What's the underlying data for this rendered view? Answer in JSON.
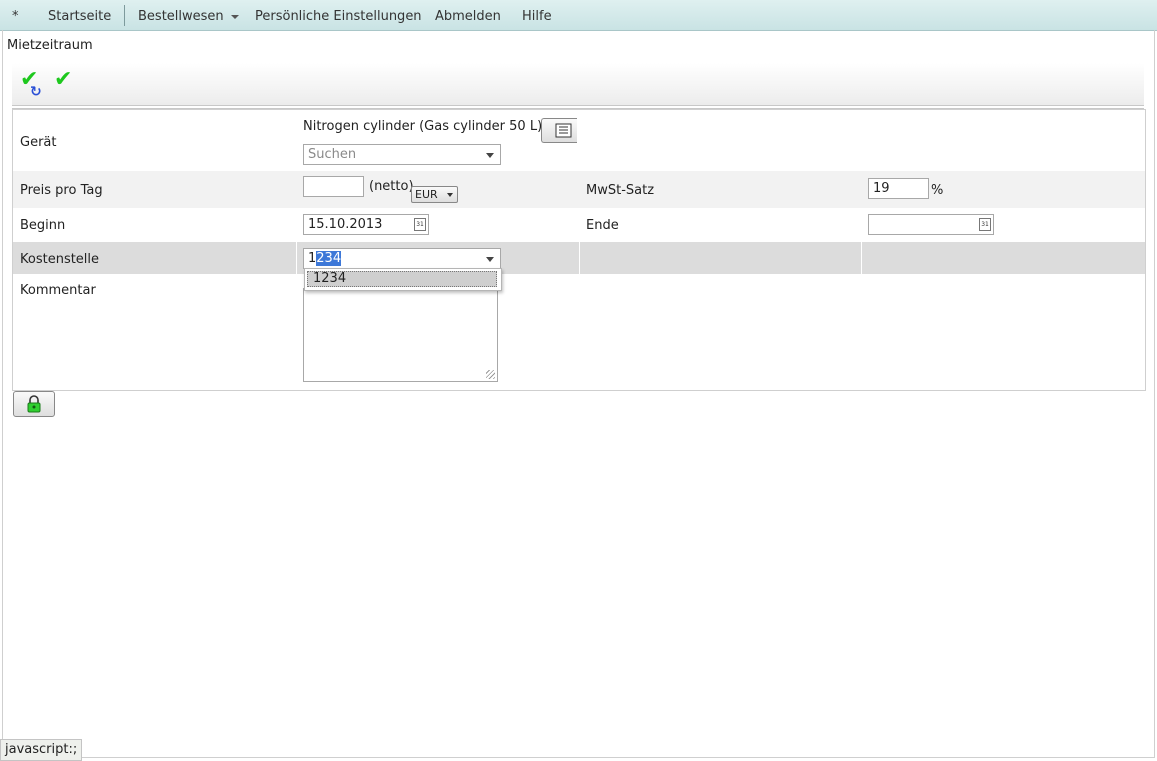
{
  "menu": {
    "star": "*",
    "home": "Startseite",
    "ordering": "Bestellwesen",
    "personal_settings": "Persönliche Einstellungen",
    "logout": "Abmelden",
    "help": "Hilfe"
  },
  "page": {
    "title": "Mietzeitraum"
  },
  "toolbar": {
    "icons": [
      "check-redo-icon",
      "check-icon"
    ]
  },
  "form": {
    "device": {
      "label": "Gerät",
      "value": "Nitrogen cylinder (Gas cylinder 50 L)",
      "search_placeholder": "Suchen"
    },
    "price": {
      "label": "Preis pro Tag",
      "value": "",
      "netto": "(netto)",
      "currency": "EUR"
    },
    "vat": {
      "label": "MwSt-Satz",
      "value": "19",
      "unit": "%"
    },
    "start": {
      "label": "Beginn",
      "value": "15.10.2013"
    },
    "end": {
      "label": "Ende",
      "value": ""
    },
    "cost_center": {
      "label": "Kostenstelle",
      "typed": "1",
      "autocomplete": "234",
      "options": [
        "1234"
      ]
    },
    "comment": {
      "label": "Kommentar",
      "value": ""
    }
  },
  "calendar_icon_text": "31",
  "status": {
    "url": "javascript:;"
  },
  "colors": {
    "menu_bg": "#cfe7e8",
    "check": "#1ec81e",
    "selection": "#3d78d8"
  }
}
